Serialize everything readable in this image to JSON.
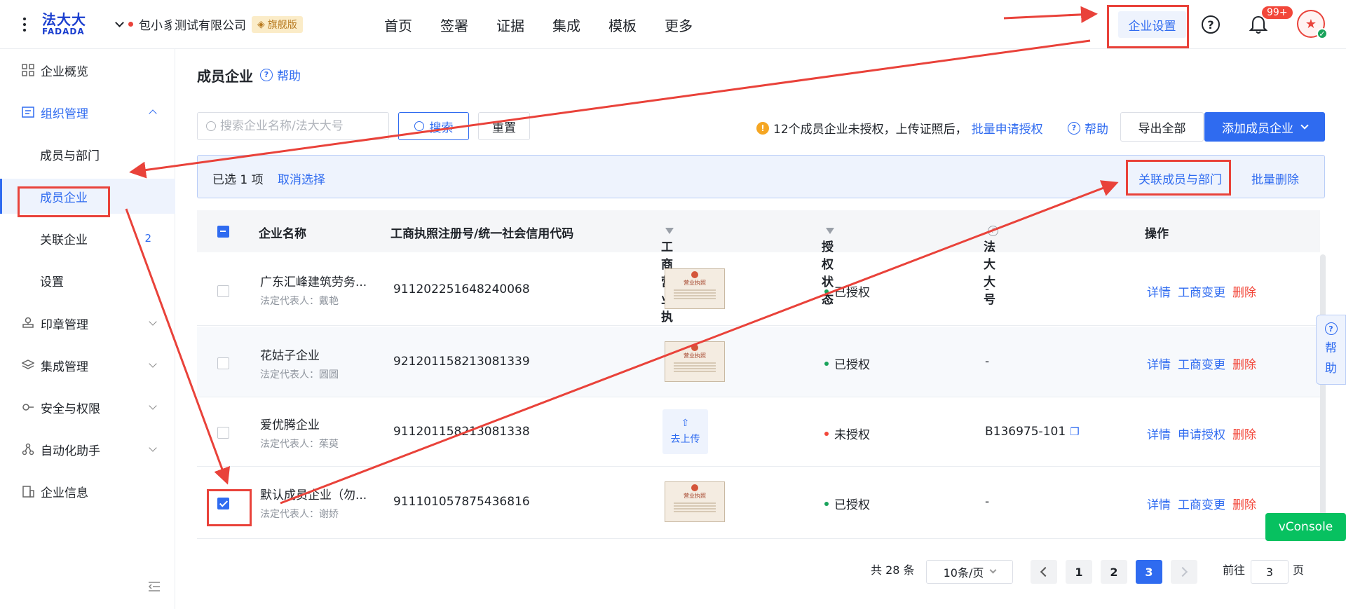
{
  "brand": {
    "name_cn": "法大大",
    "name_en": "FADADA"
  },
  "header": {
    "company": "包小豸测试有限公司",
    "edition_badge": "旗舰版",
    "nav": [
      "首页",
      "签署",
      "证据",
      "集成",
      "模板",
      "更多"
    ],
    "settings": "企业设置",
    "help_symbol": "?",
    "notifications": "99+"
  },
  "sidebar": {
    "overview": "企业概览",
    "org": "组织管理",
    "members": "成员与部门",
    "member_companies": "成员企业",
    "linked_companies": "关联企业",
    "linked_count": "2",
    "settings": "设置",
    "seal": "印章管理",
    "integration": "集成管理",
    "security": "安全与权限",
    "automation": "自动化助手",
    "info": "企业信息"
  },
  "main": {
    "title": "成员企业",
    "help": "帮助",
    "search_placeholder": "搜索企业名称/法大大号",
    "search_btn": "搜索",
    "reset_btn": "重置",
    "notice": "12个成员企业未授权，上传证照后，",
    "notice_link": "批量申请授权",
    "notice_help": "帮助",
    "export_btn": "导出全部",
    "add_btn": "添加成员企业"
  },
  "selection": {
    "selected": "已选 1 项",
    "cancel": "取消选择",
    "relate": "关联成员与部门",
    "bulk_delete": "批量删除"
  },
  "table": {
    "headers": [
      "企业名称",
      "工商执照注册号/统一社会信用代码",
      "工商营业执照",
      "授权状态",
      "法大大号",
      "操作"
    ],
    "rows": [
      {
        "name": "广东汇峰建筑劳务...",
        "rep": "法定代表人：戴艳",
        "code": "911202251648240068",
        "status": "已授权",
        "fdd": "-",
        "ops": [
          "详情",
          "工商变更",
          "删除"
        ]
      },
      {
        "name": "花姑子企业",
        "rep": "法定代表人：圆圆",
        "code": "921201158213081339",
        "status": "已授权",
        "fdd": "-",
        "ops": [
          "详情",
          "工商变更",
          "删除"
        ]
      },
      {
        "name": "爱优腾企业",
        "rep": "法定代表人：茱萸",
        "code": "911201158213081338",
        "status": "未授权",
        "fdd": "B136975-101",
        "upload": "去上传",
        "ops": [
          "详情",
          "申请授权",
          "删除"
        ]
      },
      {
        "name": "默认成员企业（勿...",
        "rep": "法定代表人：谢娇",
        "code": "911101057875436816",
        "status": "已授权",
        "fdd": "-",
        "ops": [
          "详情",
          "工商变更",
          "删除"
        ]
      }
    ],
    "license_title": "营业执照"
  },
  "pagination": {
    "total": "共 28 条",
    "page_size": "10条/页",
    "pages": [
      "1",
      "2",
      "3"
    ],
    "goto_label": "前往",
    "goto_value": "3",
    "page_suffix": "页"
  },
  "floating": {
    "help": [
      "帮",
      "助"
    ],
    "vconsole": "vConsole"
  },
  "colors": {
    "accent": "#2f6bf0",
    "danger": "#f2473a",
    "success": "#19a35b",
    "annotation": "#e9423a"
  }
}
